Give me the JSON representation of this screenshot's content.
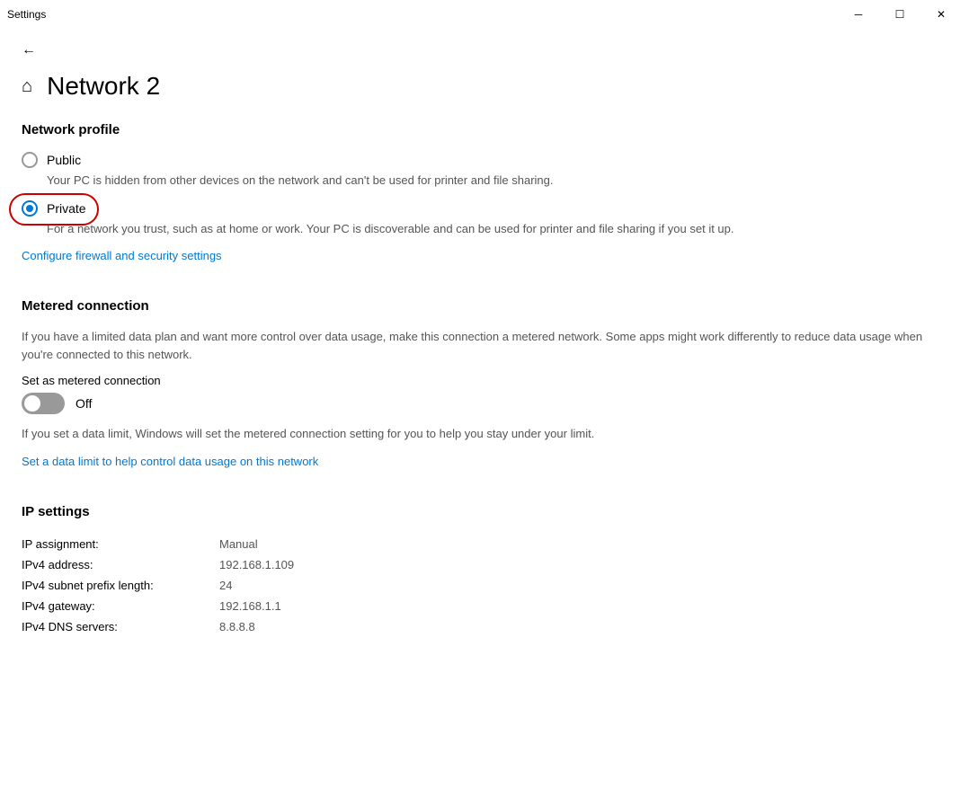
{
  "titleBar": {
    "title": "Settings",
    "minimizeLabel": "─",
    "restoreLabel": "☐",
    "closeLabel": "✕"
  },
  "header": {
    "backLabel": "←",
    "homeIcon": "⌂",
    "pageTitle": "Network 2"
  },
  "networkProfile": {
    "heading": "Network profile",
    "publicOption": {
      "label": "Public",
      "description": "Your PC is hidden from other devices on the network and can't be used for printer and file sharing.",
      "checked": false
    },
    "privateOption": {
      "label": "Private",
      "description": "For a network you trust, such as at home or work. Your PC is discoverable and can be used for printer and file sharing if you set it up.",
      "checked": true
    },
    "firewallLink": "Configure firewall and security settings"
  },
  "meteredConnection": {
    "heading": "Metered connection",
    "description": "If you have a limited data plan and want more control over data usage, make this connection a metered network. Some apps might work differently to reduce data usage when you're connected to this network.",
    "toggleLabel": "Set as metered connection",
    "toggleState": "Off",
    "toggleOn": false,
    "infoText": "If you set a data limit, Windows will set the metered connection setting for you to help you stay under your limit.",
    "dataLimitLink": "Set a data limit to help control data usage on this network"
  },
  "ipSettings": {
    "heading": "IP settings",
    "rows": [
      {
        "key": "IP assignment:",
        "value": "Manual"
      },
      {
        "key": "IPv4 address:",
        "value": "192.168.1.109"
      },
      {
        "key": "IPv4 subnet prefix length:",
        "value": "24"
      },
      {
        "key": "IPv4 gateway:",
        "value": "192.168.1.1"
      },
      {
        "key": "IPv4 DNS servers:",
        "value": "8.8.8.8"
      }
    ]
  }
}
